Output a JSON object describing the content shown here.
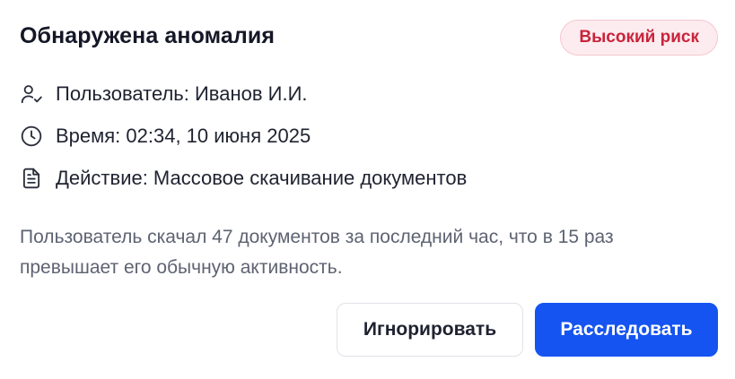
{
  "alert": {
    "title": "Обнаружена аномалия",
    "risk_badge": "Высокий риск",
    "risk_color": "#c8243b",
    "accent_color": "#1554f0",
    "details": {
      "user": {
        "icon": "user-check-icon",
        "text": "Пользователь: Иванов И.И."
      },
      "time": {
        "icon": "clock-icon",
        "text": "Время: 02:34, 10 июня 2025"
      },
      "action": {
        "icon": "document-icon",
        "text": "Действие: Массовое скачивание документов"
      }
    },
    "description": "Пользователь скачал 47 документов за последний час, что в 15 раз превышает его обычную активность.",
    "actions": {
      "ignore_label": "Игнорировать",
      "investigate_label": "Расследовать"
    }
  }
}
